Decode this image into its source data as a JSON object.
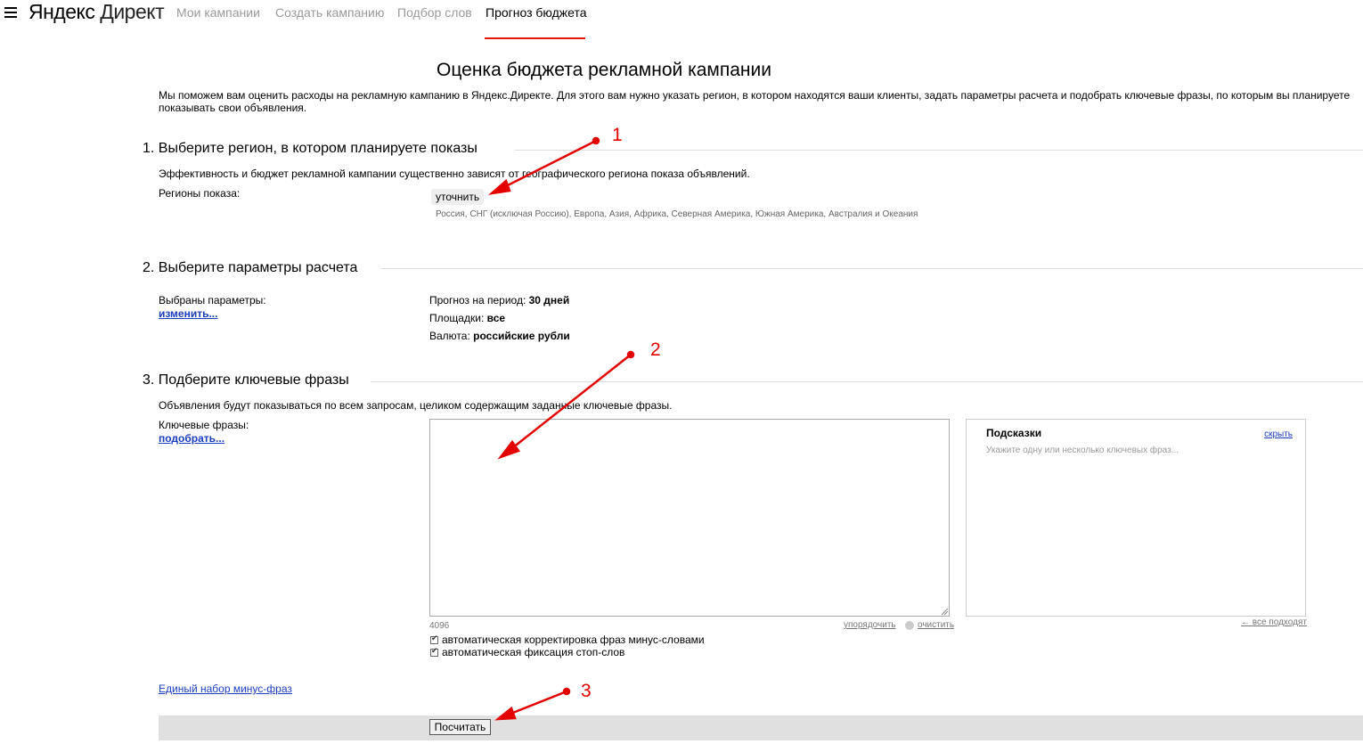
{
  "header": {
    "logo_left": "Яндекс",
    "logo_right": "Директ",
    "nav": [
      {
        "label": "Мои кампании"
      },
      {
        "label": "Создать кампанию"
      },
      {
        "label": "Подбор слов"
      },
      {
        "label": "Прогноз бюджета"
      }
    ]
  },
  "page": {
    "title": "Оценка бюджета рекламной кампании",
    "intro": "Мы поможем вам оценить расходы на рекламную кампанию в Яндекс.Директе. Для этого вам нужно указать регион, в котором находятся ваши клиенты, задать параметры расчета и подобрать ключевые фразы, по которым вы планируете показывать свои объявления."
  },
  "section1": {
    "heading": "1. Выберите регион, в котором планируете показы",
    "description": "Эффективность и бюджет рекламной кампании существенно зависят от географического региона показа объявлений.",
    "regions_label": "Регионы показа:",
    "refine_button": "уточнить",
    "regions_value": "Россия, СНГ (исключая Россию), Европа, Азия, Африка, Северная Америка, Южная Америка, Австралия и Океания"
  },
  "section2": {
    "heading": "2. Выберите параметры расчета",
    "selected_label": "Выбраны параметры:",
    "change_link": "изменить...",
    "period_label": "Прогноз на период:",
    "period_value": "30 дней",
    "platforms_label": "Площадки:",
    "platforms_value": "все",
    "currency_label": "Валюта:",
    "currency_value": "российские рубли"
  },
  "section3": {
    "heading": "3. Подберите ключевые фразы",
    "description": "Объявления будут показываться по всем запросам, целиком содержащим заданные ключевые фразы.",
    "keywords_label": "Ключевые фразы:",
    "pick_link": "подобрать...",
    "textarea_value": "",
    "char_counter": "4096",
    "sort_link": "упорядочить",
    "clear_link": "очистить",
    "check_minus": "автоматическая корректировка фраз минус-словами",
    "check_stop": "автоматическая фиксация стоп-слов",
    "hints_title": "Подсказки",
    "hints_hide": "скрыть",
    "hints_placeholder": "Укажите одну или несколько ключевых фраз...",
    "hints_all": "все подходят",
    "minus_set_link": "Единый набор минус-фраз",
    "calc_button": "Посчитать"
  },
  "annotations": {
    "labels": [
      "1",
      "2",
      "3"
    ],
    "color": "#e30000"
  }
}
